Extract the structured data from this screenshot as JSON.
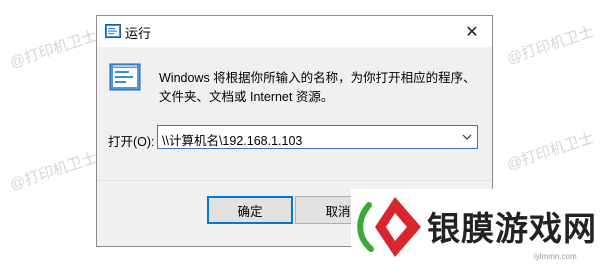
{
  "watermark": "@打印机卫士",
  "dialog": {
    "title": "运行",
    "close_symbol": "✕",
    "description": "Windows 将根据你所输入的名称，为你打开相应的程序、文件夹、文档或 Internet 资源。",
    "open_label": "打开(O):",
    "open_value": "\\\\计算机名\\192.168.1.103",
    "ok_label": "确定",
    "cancel_label": "取消"
  },
  "brand": {
    "name": "银膜游戏网",
    "url": "iylmmn.com"
  },
  "colors": {
    "accent": "#0078d7",
    "brand_red": "#d9262c",
    "brand_green": "#3aa935"
  }
}
